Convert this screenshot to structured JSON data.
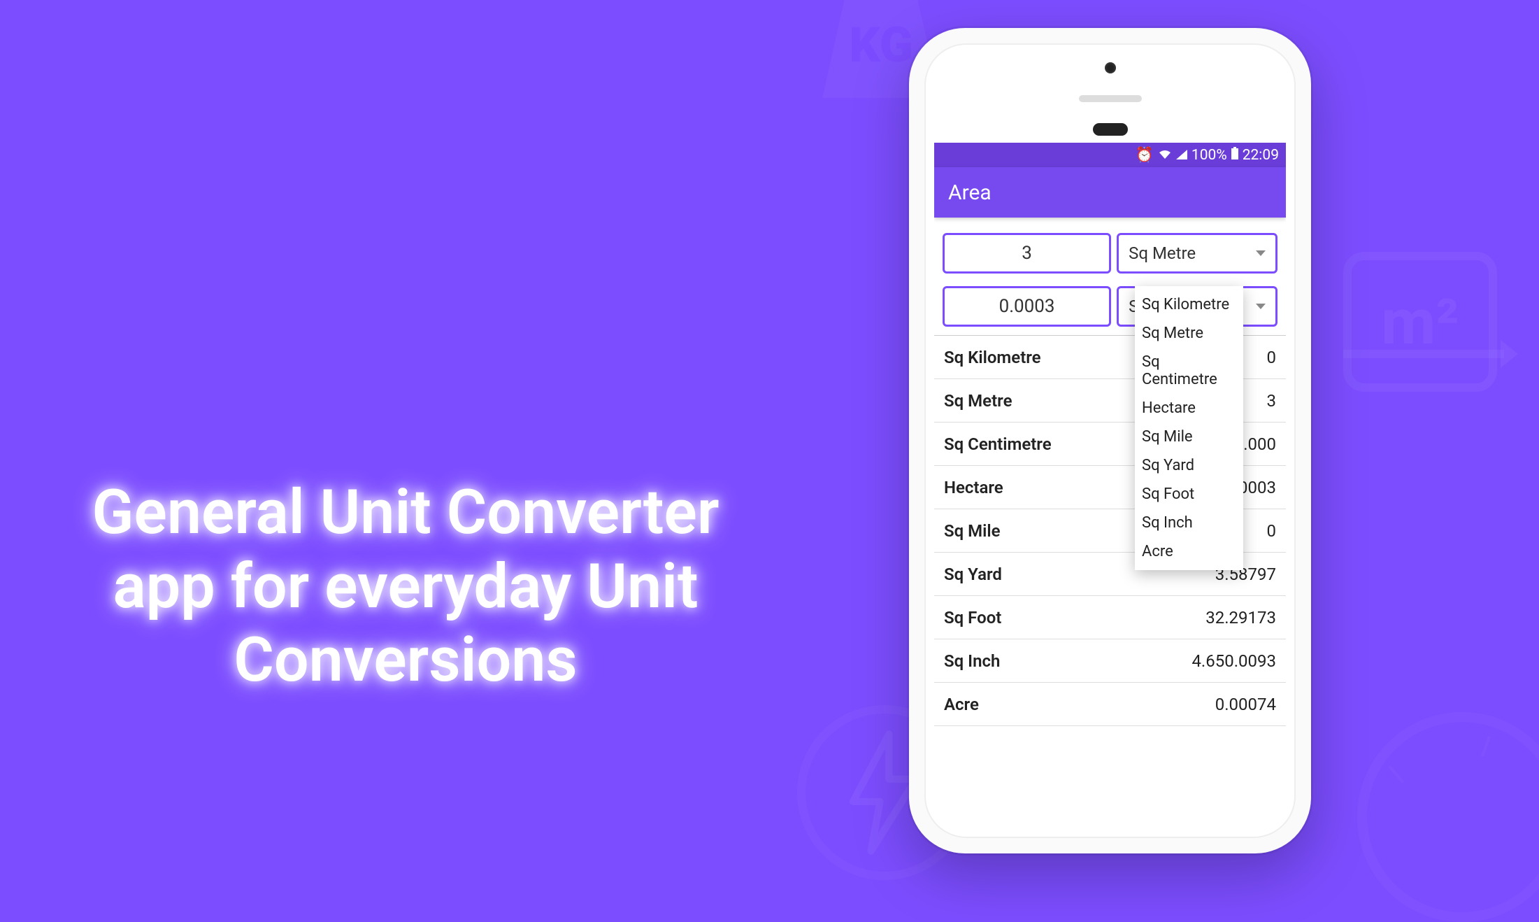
{
  "marketing": {
    "headline": "General Unit Converter app for everyday Unit Conversions",
    "kg_label": "KG",
    "m2_label": "m²"
  },
  "status": {
    "battery_pct": "100%",
    "time": "22:09"
  },
  "app": {
    "title": "Area"
  },
  "inputs": {
    "source_value": "3",
    "source_unit": "Sq Metre",
    "target_value": "0.0003",
    "target_unit": "Sq Kilometre"
  },
  "dropdown": [
    "Sq Kilometre",
    "Sq Metre",
    "Sq Centimetre",
    "Hectare",
    "Sq Mile",
    "Sq Yard",
    "Sq Foot",
    "Sq Inch",
    "Acre"
  ],
  "results": [
    {
      "unit": "Sq Kilometre",
      "value": "0"
    },
    {
      "unit": "Sq Metre",
      "value": "3"
    },
    {
      "unit": "Sq Centimetre",
      "value": "30.000"
    },
    {
      "unit": "Hectare",
      "value": "0.0003"
    },
    {
      "unit": "Sq Mile",
      "value": "0"
    },
    {
      "unit": "Sq Yard",
      "value": "3.58797"
    },
    {
      "unit": "Sq Foot",
      "value": "32.29173"
    },
    {
      "unit": "Sq Inch",
      "value": "4.650.0093"
    },
    {
      "unit": "Acre",
      "value": "0.00074"
    }
  ]
}
